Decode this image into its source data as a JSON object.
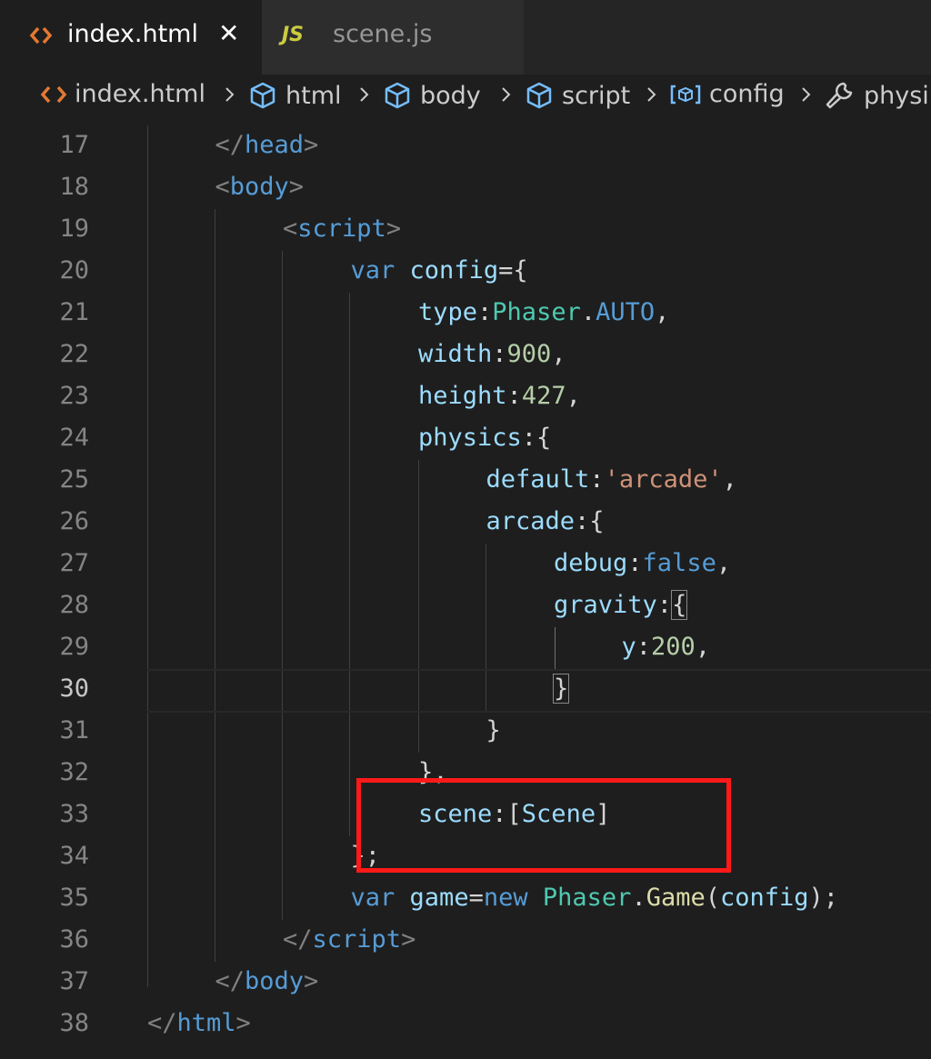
{
  "tabs": [
    {
      "label": "index.html",
      "icon": "html-icon",
      "active": true,
      "close": "✕"
    },
    {
      "label": "scene.js",
      "icon": "js-icon",
      "badge": "JS",
      "active": false
    }
  ],
  "breadcrumb": {
    "items": [
      {
        "label": "index.html",
        "icon": "html-file-icon"
      },
      {
        "label": "html",
        "icon": "cube-icon"
      },
      {
        "label": "body",
        "icon": "cube-icon"
      },
      {
        "label": "script",
        "icon": "cube-icon"
      },
      {
        "label": "config",
        "icon": "variable-icon"
      },
      {
        "label": "physi",
        "icon": "wrench-icon"
      }
    ]
  },
  "editor": {
    "current_line": "30",
    "lines": [
      {
        "n": "17",
        "tokens": [
          [
            "tag",
            "</"
          ],
          [
            "tagname",
            "head"
          ],
          [
            "tag",
            ">"
          ]
        ]
      },
      {
        "n": "18",
        "tokens": [
          [
            "tag",
            "<"
          ],
          [
            "tagname",
            "body"
          ],
          [
            "tag",
            ">"
          ]
        ]
      },
      {
        "n": "19",
        "tokens": [
          [
            "tag",
            "<"
          ],
          [
            "tagname",
            "script"
          ],
          [
            "tag",
            ">"
          ]
        ]
      },
      {
        "n": "20",
        "tokens": [
          [
            "kw",
            "var"
          ],
          [
            "punc",
            " "
          ],
          [
            "var",
            "config"
          ],
          [
            "punc",
            "={"
          ]
        ]
      },
      {
        "n": "21",
        "tokens": [
          [
            "var",
            "type"
          ],
          [
            "punc",
            ":"
          ],
          [
            "cls",
            "Phaser"
          ],
          [
            "punc",
            "."
          ],
          [
            "kw",
            "AUTO"
          ],
          [
            "punc",
            ","
          ]
        ]
      },
      {
        "n": "22",
        "tokens": [
          [
            "var",
            "width"
          ],
          [
            "punc",
            ":"
          ],
          [
            "num",
            "900"
          ],
          [
            "punc",
            ","
          ]
        ]
      },
      {
        "n": "23",
        "tokens": [
          [
            "var",
            "height"
          ],
          [
            "punc",
            ":"
          ],
          [
            "num",
            "427"
          ],
          [
            "punc",
            ","
          ]
        ]
      },
      {
        "n": "24",
        "tokens": [
          [
            "var",
            "physics"
          ],
          [
            "punc",
            ":{"
          ]
        ]
      },
      {
        "n": "25",
        "tokens": [
          [
            "var",
            "default"
          ],
          [
            "punc",
            ":"
          ],
          [
            "str",
            "'arcade'"
          ],
          [
            "punc",
            ","
          ]
        ]
      },
      {
        "n": "26",
        "tokens": [
          [
            "var",
            "arcade"
          ],
          [
            "punc",
            ":{"
          ]
        ]
      },
      {
        "n": "27",
        "tokens": [
          [
            "var",
            "debug"
          ],
          [
            "punc",
            ":"
          ],
          [
            "kw",
            "false"
          ],
          [
            "punc",
            ","
          ]
        ]
      },
      {
        "n": "28",
        "tokens": [
          [
            "var",
            "gravity"
          ],
          [
            "punc",
            ":"
          ],
          [
            "match",
            "{"
          ]
        ]
      },
      {
        "n": "29",
        "tokens": [
          [
            "var",
            "y"
          ],
          [
            "punc",
            ":"
          ],
          [
            "num",
            "200"
          ],
          [
            "punc",
            ","
          ]
        ]
      },
      {
        "n": "30",
        "tokens": [
          [
            "match",
            "}"
          ]
        ]
      },
      {
        "n": "31",
        "tokens": [
          [
            "punc",
            "}"
          ]
        ]
      },
      {
        "n": "32",
        "tokens": [
          [
            "punc",
            "},"
          ]
        ]
      },
      {
        "n": "33",
        "tokens": [
          [
            "var",
            "scene"
          ],
          [
            "punc",
            ":["
          ],
          [
            "var",
            "Scene"
          ],
          [
            "punc",
            "]"
          ]
        ]
      },
      {
        "n": "34",
        "tokens": [
          [
            "punc",
            "};"
          ]
        ]
      },
      {
        "n": "35",
        "tokens": [
          [
            "kw",
            "var"
          ],
          [
            "punc",
            " "
          ],
          [
            "var",
            "game"
          ],
          [
            "punc",
            "="
          ],
          [
            "kw",
            "new"
          ],
          [
            "punc",
            " "
          ],
          [
            "cls",
            "Phaser"
          ],
          [
            "punc",
            "."
          ],
          [
            "fn",
            "Game"
          ],
          [
            "punc",
            "("
          ],
          [
            "var",
            "config"
          ],
          [
            "punc",
            ");"
          ]
        ]
      },
      {
        "n": "36",
        "tokens": [
          [
            "tag",
            "</"
          ],
          [
            "tagname",
            "script"
          ],
          [
            "tag",
            ">"
          ]
        ]
      },
      {
        "n": "37",
        "tokens": [
          [
            "tag",
            "</"
          ],
          [
            "tagname",
            "body"
          ],
          [
            "tag",
            ">"
          ]
        ]
      },
      {
        "n": "38",
        "tokens": [
          [
            "tag",
            "</"
          ],
          [
            "tagname",
            "html"
          ],
          [
            "tag",
            ">"
          ]
        ]
      }
    ]
  },
  "colors": {
    "highlight_box": "#ff1a1a",
    "keyword": "#569cd6",
    "variable": "#9cdcfe",
    "number": "#b5cea8",
    "string": "#ce9178",
    "class": "#4ec9b0"
  }
}
